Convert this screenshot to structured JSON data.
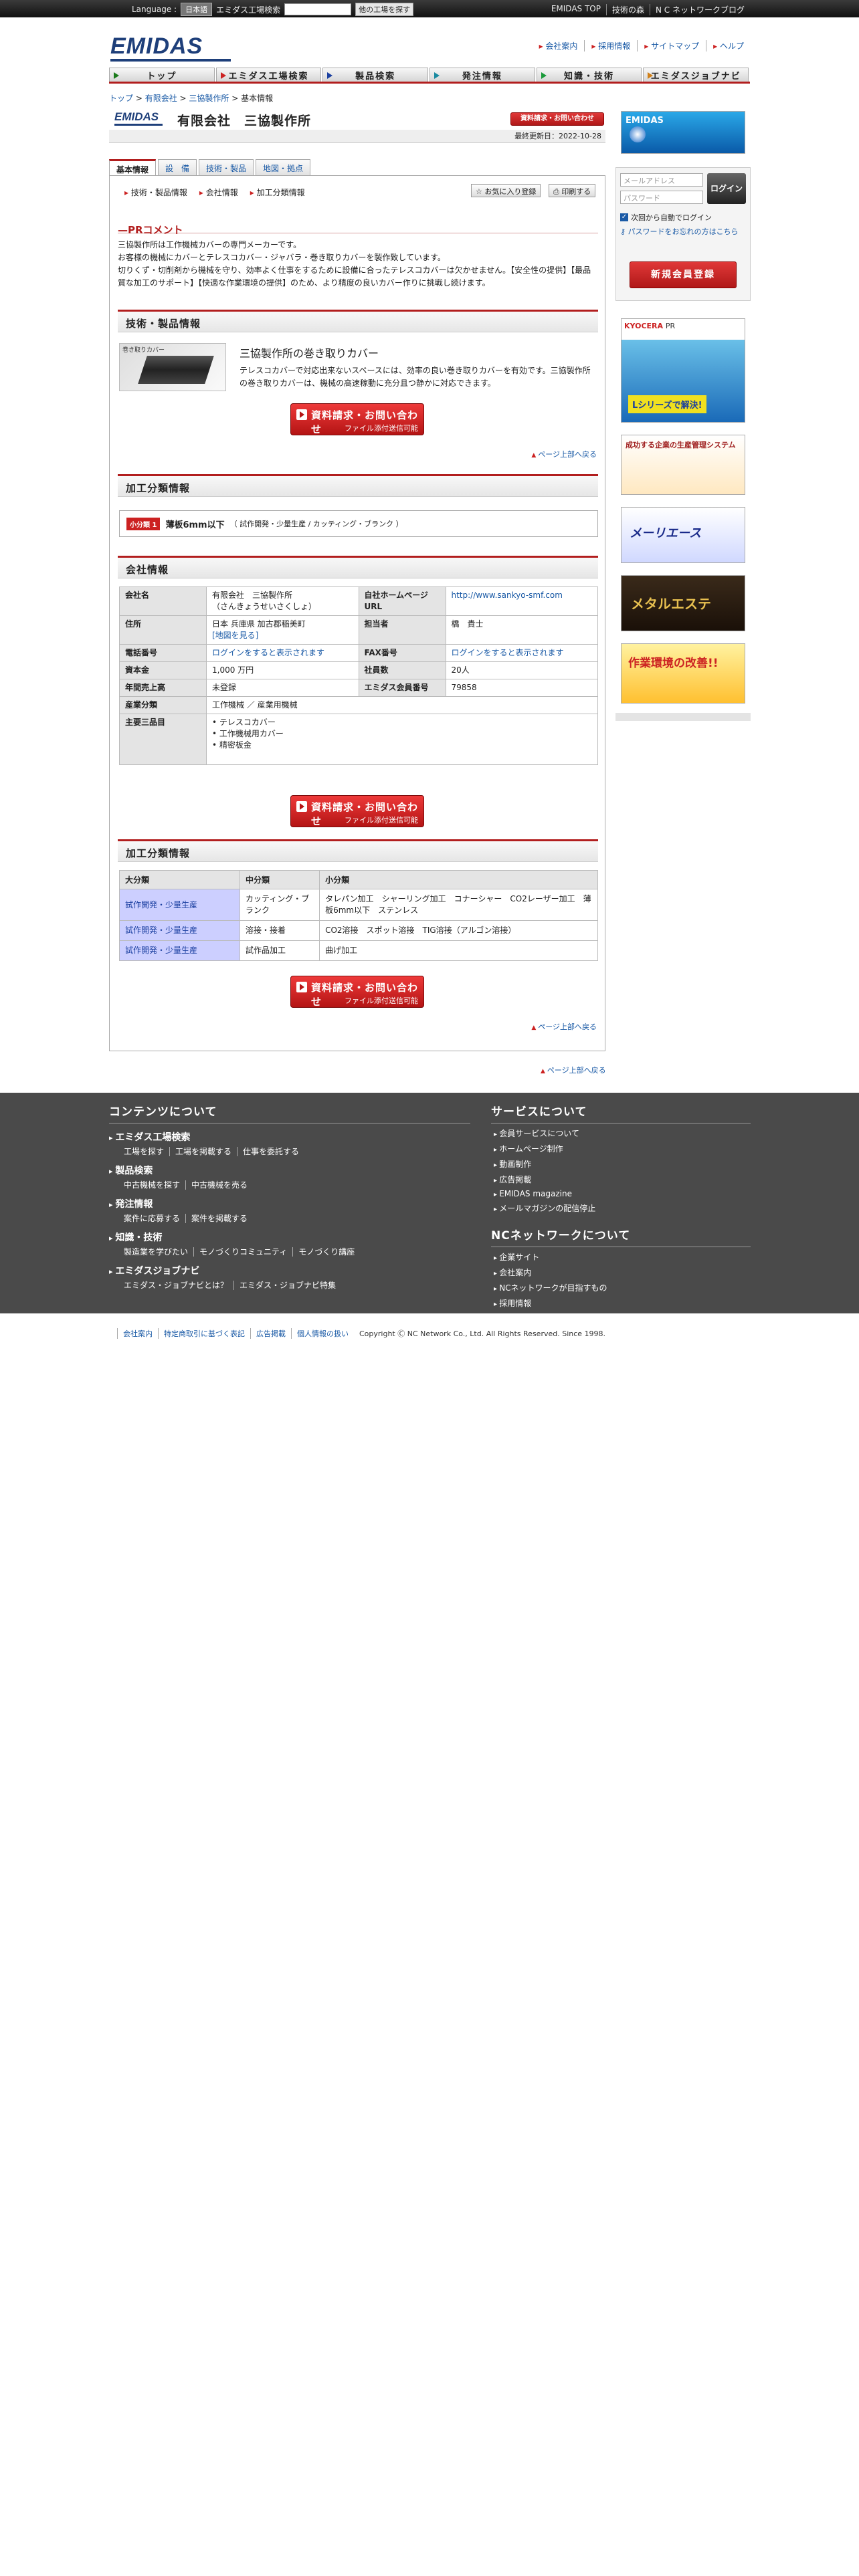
{
  "topbar": {
    "language_label": "Language :",
    "language_value": "日本語",
    "factory_search_label": "エミダス工場検索",
    "search_button": "他の工場を探す",
    "links": [
      "EMIDAS TOP",
      "技術の森",
      "N C ネットワークブログ"
    ]
  },
  "header": {
    "logo": "EMIDAS",
    "links": [
      "会社案内",
      "採用情報",
      "サイトマップ",
      "ヘルプ"
    ]
  },
  "nav": [
    "トップ",
    "エミダス工場検索",
    "製品検索",
    "発注情報",
    "知識・技術",
    "エミダスジョブナビ"
  ],
  "breadcrumb": [
    "トップ",
    "有限会社",
    "三協製作所",
    "基本情報"
  ],
  "company": {
    "logo": "EMIDAS",
    "name": "有限会社　三協製作所",
    "contact_button": "資料請求・お問い合わせ",
    "updated": "最終更新日：2022-10-28"
  },
  "tabs": [
    "基本情報",
    "設　備",
    "技術・製品",
    "地図・拠点"
  ],
  "sublinks": [
    "技術・製品情報",
    "会社情報",
    "加工分類情報"
  ],
  "actions": {
    "favorite": "お気に入り登録",
    "print": "印刷する"
  },
  "pr": {
    "title": "PRコメント",
    "lines": [
      "三協製作所は工作機械カバーの専門メーカーです。",
      "お客様の機械にカバーとテレスコカバー・ジャバラ・巻き取りカバーを製作致しています。",
      "切りくず・切削剤から機械を守り、効率よく仕事をするために設備に合ったテレスコカバーは欠かせません。【安全性の提供】【最品質な加工のサポート】【快適な作業環境の提供】のため、より精度の良いカバー作りに挑戦し続けます。"
    ]
  },
  "tech": {
    "title": "技術・製品情報",
    "image_label": "巻き取りカバー",
    "product_name": "三協製作所の巻き取りカバー",
    "desc": "テレスコカバーで対応出来ないスペースには、効率の良い巻き取りカバーを有効です。三協製作所の巻き取りカバーは、機械の高速稼動に充分且つ静かに対応できます。"
  },
  "cta": {
    "line1": "資料請求・お問い合わせ",
    "line2": "ファイル添付送信可能"
  },
  "pagetop": "ページ上部へ戻る",
  "proc_summary": {
    "title": "加工分類情報",
    "badge": "小分類",
    "num": "1",
    "main": "薄板6mm以下",
    "path": "（ 試作開発・少量生産 / カッティング・ブランク ）"
  },
  "company_info": {
    "title": "会社情報",
    "rows": [
      {
        "k1": "会社名",
        "v1": "有限会社　三協製作所",
        "v1b": "（さんきょうせいさくしょ）",
        "k2": "自社ホームページURL",
        "v2": "http://www.sankyo-smf.com"
      },
      {
        "k1": "住所",
        "v1": "日本 兵庫県 加古郡稲美町",
        "v1b": "[地図を見る]",
        "k2": "担当者",
        "v2": "橋　貴士"
      },
      {
        "k1": "電話番号",
        "v1": "ログインをすると表示されます",
        "k2": "FAX番号",
        "v2": "ログインをすると表示されます"
      },
      {
        "k1": "資本金",
        "v1": "1,000 万円",
        "k2": "社員数",
        "v2": "20人"
      },
      {
        "k1": "年間売上高",
        "v1": "未登録",
        "k2": "エミダス会員番号",
        "v2": "79858"
      }
    ],
    "industry_label": "産業分類",
    "industry": "工作機械 ／ 産業用機械",
    "products_label": "主要三品目",
    "products": [
      "テレスコカバー",
      "工作機械用カバー",
      "精密板金"
    ]
  },
  "proc_table": {
    "title": "加工分類情報",
    "headers": [
      "大分類",
      "中分類",
      "小分類"
    ],
    "rows": [
      [
        "試作開発・少量生産",
        "カッティング・ブランク",
        "タレパン加工　シャーリング加工　コナーシャー　CO2レーザー加工　薄板6mm以下　ステンレス"
      ],
      [
        "試作開発・少量生産",
        "溶接・接着",
        "CO2溶接　スポット溶接　TIG溶接（アルゴン溶接）"
      ],
      [
        "試作開発・少量生産",
        "試作品加工",
        "曲げ加工"
      ]
    ]
  },
  "sidebar": {
    "ad1": "EMIDAS",
    "email_placeholder": "メールアドレス",
    "password_placeholder": "パスワード",
    "login_button": "ログイン",
    "remember": "次回から自動でログイン",
    "forgot": "パスワードをお忘れの方はこちら",
    "register": "新規会員登録",
    "ad2_brand": "KYOCERA",
    "ad2_tag": "PR",
    "ad2_text": "Lシリーズで解決!",
    "ad3_text": "成功する企業の生産管理システム",
    "ad4_text": "メーリエース",
    "ad5_text": "メタルエステ",
    "ad6_text": "作業環境の改善!!"
  },
  "footer": {
    "contents_title": "コンテンツについて",
    "contents": [
      {
        "title": "エミダス工場検索",
        "subs": [
          "工場を探す",
          "工場を掲載する",
          "仕事を委託する"
        ]
      },
      {
        "title": "製品検索",
        "subs": [
          "中古機械を探す",
          "中古機械を売る"
        ]
      },
      {
        "title": "発注情報",
        "subs": [
          "案件に応募する",
          "案件を掲載する"
        ]
      },
      {
        "title": "知識・技術",
        "subs": [
          "製造業を学びたい",
          "モノづくりコミュニティ",
          "モノづくり講座"
        ]
      },
      {
        "title": "エミダスジョブナビ",
        "subs": [
          "エミダス・ジョブナビとは？",
          "エミダス・ジョブナビ特集"
        ]
      }
    ],
    "services_title": "サービスについて",
    "services": [
      "会員サービスについて",
      "ホームページ制作",
      "動画制作",
      "広告掲載",
      "EMIDAS magazine",
      "メールマガジンの配信停止"
    ],
    "nc_title": "NCネットワークについて",
    "nc": [
      "企業サイト",
      "会社案内",
      "NCネットワークが目指すもの",
      "採用情報"
    ]
  },
  "bottom": {
    "links": [
      "会社案内",
      "特定商取引に基づく表記",
      "広告掲載",
      "個人情報の扱い"
    ],
    "copyright": "Copyright Ⓒ NC Network Co., Ltd. All Rights Reserved. Since 1998."
  },
  "colors": {
    "brand": "#1e3f7a",
    "accent": "#b21e1e",
    "link": "#1a5aa6",
    "footer_bg": "#4a4a4a"
  }
}
